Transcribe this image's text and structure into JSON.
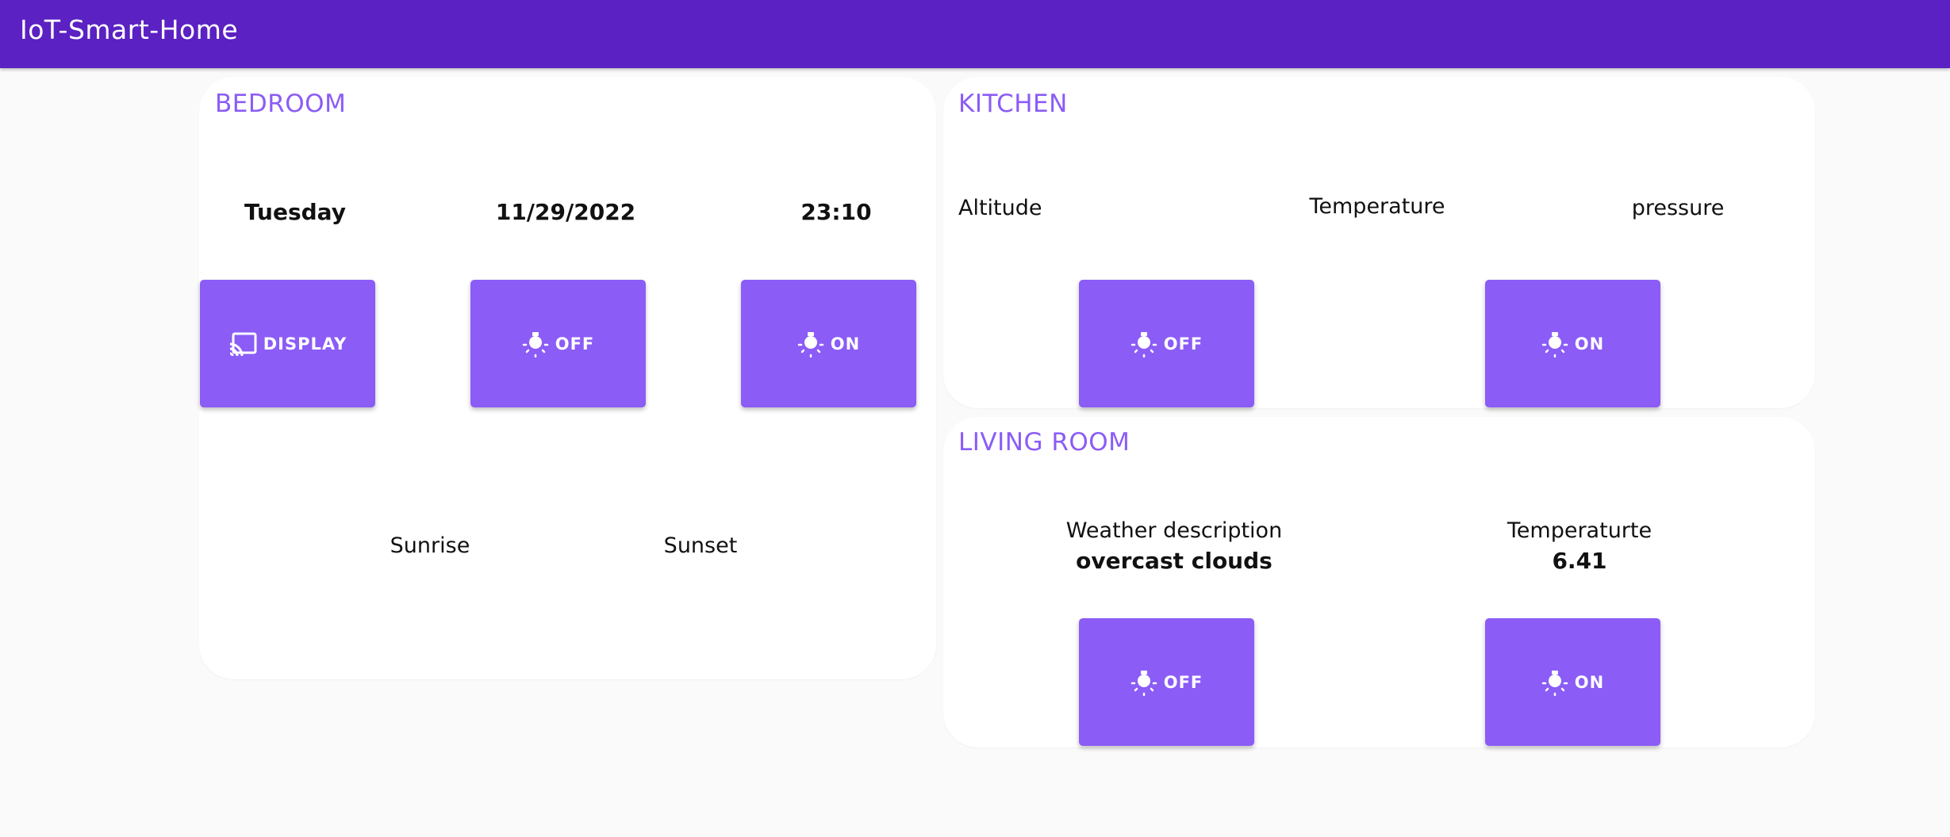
{
  "app": {
    "title": "IoT-Smart-Home"
  },
  "colors": {
    "appbar": "#5b21c2",
    "accent": "#8b5cf6",
    "background": "#fafafa",
    "card": "#ffffff"
  },
  "bedroom": {
    "title": "BEDROOM",
    "day": "Tuesday",
    "date": "11/29/2022",
    "time": "23:10",
    "display_button": {
      "label": "DISPLAY",
      "icon": "cast-icon"
    },
    "off_button": {
      "label": "OFF",
      "icon": "lightbulb-icon"
    },
    "on_button": {
      "label": "ON",
      "icon": "lightbulb-icon"
    },
    "sunrise_label": "Sunrise",
    "sunset_label": "Sunset"
  },
  "kitchen": {
    "title": "KITCHEN",
    "altitude_label": "Altitude",
    "temperature_label": "Temperature",
    "pressure_label": "pressure",
    "off_button": {
      "label": "OFF",
      "icon": "lightbulb-icon"
    },
    "on_button": {
      "label": "ON",
      "icon": "lightbulb-icon"
    }
  },
  "living_room": {
    "title": "LIVING ROOM",
    "weather_label": "Weather description",
    "weather_value": "overcast clouds",
    "temperature_label": "Temperaturte",
    "temperature_value": "6.41",
    "off_button": {
      "label": "OFF",
      "icon": "lightbulb-icon"
    },
    "on_button": {
      "label": "ON",
      "icon": "lightbulb-icon"
    }
  }
}
